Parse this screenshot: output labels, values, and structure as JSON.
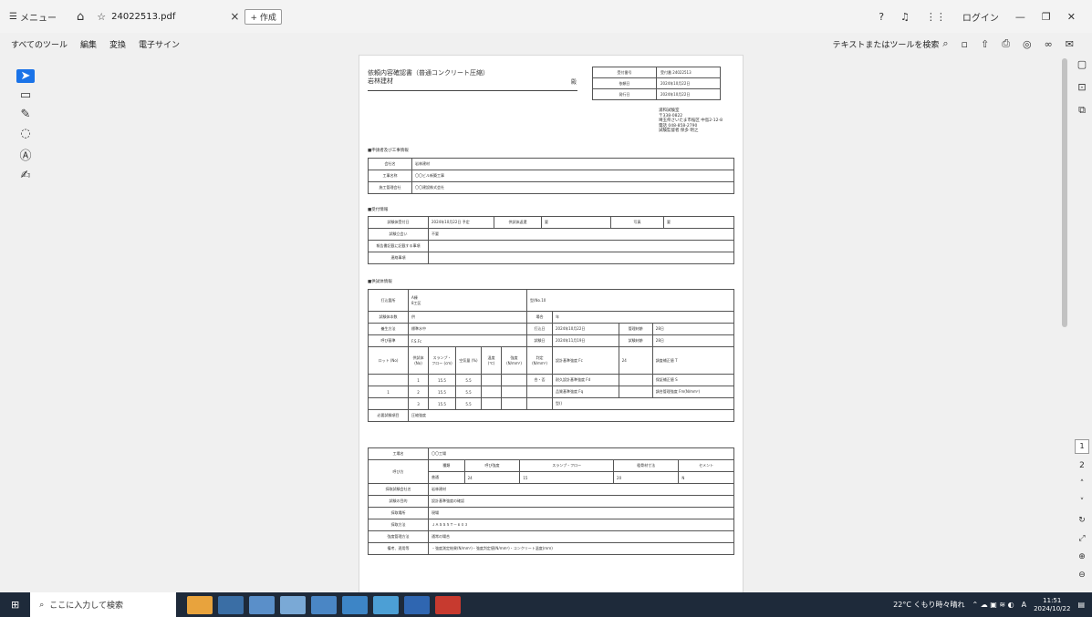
{
  "topbar": {
    "menu_label": "メニュー",
    "tab_title": "24022513.pdf",
    "new_label": "作成",
    "login_label": "ログイン"
  },
  "toolbar": {
    "items": [
      "すべてのツール",
      "編集",
      "変換",
      "電子サイン"
    ],
    "search_label": "テキストまたはツールを検索"
  },
  "document": {
    "title": "依頼内容確認書（普通コンクリート圧縮）",
    "recipient": "岩林建材",
    "dono": "殿",
    "header_rows": [
      {
        "k": "受付番号",
        "v": "受付番 24022513"
      },
      {
        "k": "依頼日",
        "v": "2024年10月22日"
      },
      {
        "k": "発行日",
        "v": "2024年10月22日"
      }
    ],
    "lab_lines": [
      "浦和試験室",
      "〒338-0822",
      "埼玉県さいたま市桜区 中島2-12-8",
      "電話 048-858-2790",
      "試験監督者 保多 明之"
    ],
    "sec1": "■申請者及び工事情報",
    "sec1_rows": [
      {
        "k": "会社名",
        "v": "岩林建材"
      },
      {
        "k": "工事名称",
        "v": "〇〇ビル新築工事"
      },
      {
        "k": "施工管理会社",
        "v": "〇〇建設株式会社"
      }
    ],
    "sec2": "■受付情報",
    "sec2_rows": [
      {
        "k": "試験体受付日",
        "v": "2024年10月22日 予定",
        "k2": "供試体返還",
        "v2": "要",
        "k3": "写真",
        "v3": "要"
      },
      {
        "k": "試験立会い",
        "v": "不要"
      },
      {
        "k": "報告書記載に記載する事項",
        "v": ""
      },
      {
        "k": "連絡事項",
        "v": ""
      }
    ],
    "sec3": "■供試体情報",
    "sec3_rows": {
      "r1_k": "打込箇所",
      "r1_v1": "A棟",
      "r1_v2": "8工区",
      "r1_v3": "型(No.10",
      "r2_k": "試験体本数",
      "r2_v": "供",
      "r2_k2": "場合",
      "r2_v2": "年",
      "r3_k": "養生方法",
      "r3_v": "標準水中",
      "r3_k2": "打込日",
      "r3_v2": "2024年10月22日",
      "r3_k3": "管理材齢",
      "r3_v3": "28日",
      "r4_k": "呼び基準",
      "r4_v": "F.S.Fc",
      "r4_k2": "試験日",
      "r4_v2": "2024年11月19日",
      "r4_k3": "試験材齢",
      "r4_v3": "28日",
      "hdr": [
        "ロット (No)",
        "供試体 (No)",
        "スランプ・フロー (cm)",
        "空気量 (%)",
        "温度 (℃)",
        "強度 (N/mm²)",
        "判定 (N/mm²)"
      ],
      "rows": [
        {
          "lot": "",
          "no": "1",
          "sl": "15.5",
          "air": "5.5",
          "t": "",
          "s": "",
          "j": "合・否"
        },
        {
          "lot": "1",
          "no": "2",
          "sl": "15.5",
          "air": "5.5",
          "t": "",
          "s": "",
          "j": ""
        },
        {
          "lot": "",
          "no": "3",
          "sl": "15.5",
          "air": "5.5",
          "t": "",
          "s": "",
          "j": ""
        }
      ],
      "side": [
        "設計基準強度 Fc",
        "24",
        "調査補正値 T",
        "",
        "耐久設計基準強度 Fd",
        "",
        "保証補正値 S",
        "",
        "品質基準強度 Fq",
        "",
        "調合管理強度 Fm(N/mm²)",
        "24",
        "型()",
        ""
      ],
      "last_k": "必要試験項目",
      "last_v": "圧縮強度"
    },
    "sec4_rows": {
      "factory_k": "工場名",
      "factory_v": "〇〇工場",
      "mix_k": "呼び方",
      "mix_hdr": [
        "種類",
        "呼び強度",
        "スランプ・フロー",
        "粗骨材寸法",
        "セメント"
      ],
      "mix_vals": [
        "普通",
        "24",
        "15",
        "20",
        "N"
      ],
      "other": [
        {
          "k": "採取試験会社名",
          "v": "岩林建材"
        },
        {
          "k": "試験の目的",
          "v": "設計基準強度の確認"
        },
        {
          "k": "採取場所",
          "v": "現場"
        },
        {
          "k": "採取方法",
          "v": "ＪＡＳＳ５Ｔ－６０３"
        },
        {
          "k": "強度管理方法",
          "v": "通常の場合"
        },
        {
          "k": "備考、適用等",
          "v": "・強度測定結果(N/mm²)・強度判定値(N/mm²)・コンクリート温度(ｍｍ)"
        }
      ]
    }
  },
  "page_nav": {
    "current": "1",
    "total": "2"
  },
  "taskbar": {
    "search_placeholder": "ここに入力して検索",
    "weather": "22°C くもり時々晴れ",
    "ime": "A",
    "time": "11:51",
    "date": "2024/10/22"
  }
}
